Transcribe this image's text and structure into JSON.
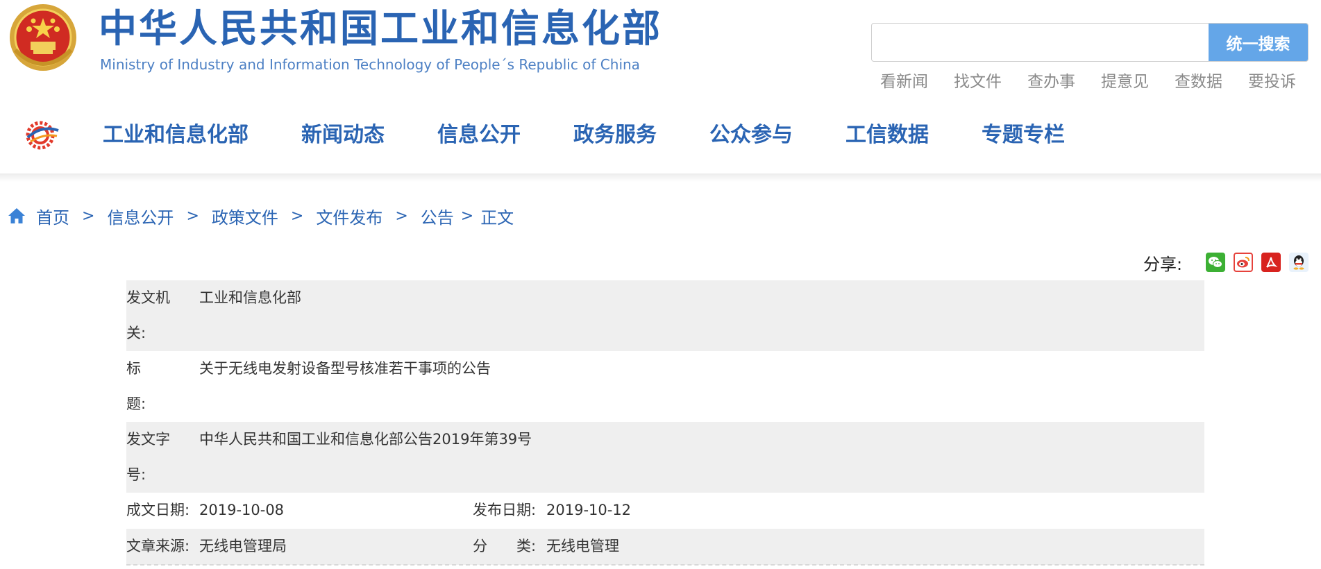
{
  "header": {
    "title": "中华人民共和国工业和信息化部",
    "subtitle": "Ministry of Industry and Information Technology of People´s Republic of China",
    "search": {
      "placeholder": "",
      "button_label": "统一搜索"
    },
    "quick_links": [
      "看新闻",
      "找文件",
      "查办事",
      "提意见",
      "查数据",
      "要投诉"
    ]
  },
  "nav": {
    "items": [
      "工业和信息化部",
      "新闻动态",
      "信息公开",
      "政务服务",
      "公众参与",
      "工信数据",
      "专题专栏"
    ]
  },
  "breadcrumb": {
    "items": [
      "首页",
      "信息公开",
      "政策文件",
      "文件发布",
      "公告",
      "正文"
    ],
    "separator": ">"
  },
  "share": {
    "label": "分享:",
    "icons": [
      "wechat-icon",
      "weibo-icon",
      "pdf-icon",
      "qq-icon"
    ]
  },
  "meta": {
    "issuer_label_1": "发文机",
    "issuer_label_2": "关:",
    "issuer_value": "工业和信息化部",
    "title_label_1": "标",
    "title_label_2": "题:",
    "title_value": "关于无线电发射设备型号核准若干事项的公告",
    "doc_no_label_1": "发文字",
    "doc_no_label_2": "号:",
    "doc_no_value": "中华人民共和国工业和信息化部公告2019年第39号",
    "written_date_label": "成文日期:",
    "written_date_value": "2019-10-08",
    "publish_date_label": "发布日期:",
    "publish_date_value": "2019-10-12",
    "source_label": "文章来源:",
    "source_value": "无线电管理局",
    "category_label": "分　　类:",
    "category_value": "无线电管理"
  },
  "colors": {
    "brand_blue": "#2a64b3",
    "search_button": "#64a6e8",
    "row_shade": "#efefef"
  }
}
